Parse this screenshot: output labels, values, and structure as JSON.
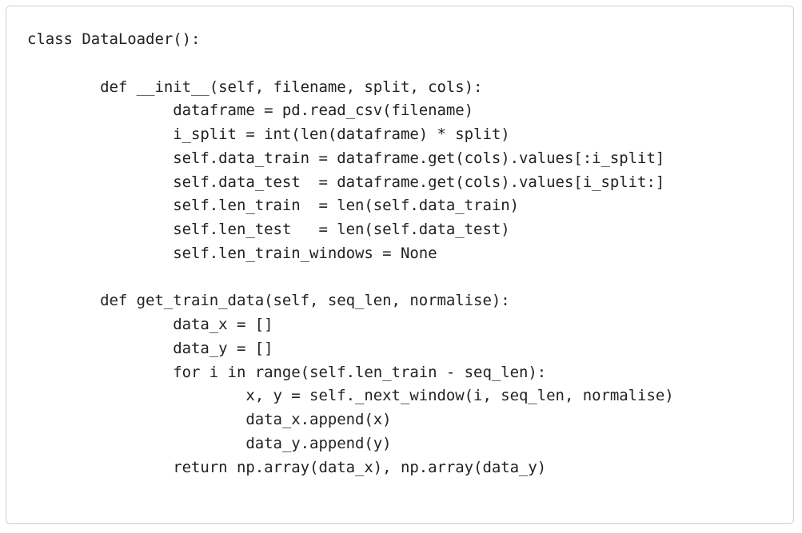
{
  "code": {
    "lines": [
      "class DataLoader():",
      "",
      "        def __init__(self, filename, split, cols):",
      "                dataframe = pd.read_csv(filename)",
      "                i_split = int(len(dataframe) * split)",
      "                self.data_train = dataframe.get(cols).values[:i_split]",
      "                self.data_test  = dataframe.get(cols).values[i_split:]",
      "                self.len_train  = len(self.data_train)",
      "                self.len_test   = len(self.data_test)",
      "                self.len_train_windows = None",
      "",
      "        def get_train_data(self, seq_len, normalise):",
      "                data_x = []",
      "                data_y = []",
      "                for i in range(self.len_train - seq_len):",
      "                        x, y = self._next_window(i, seq_len, normalise)",
      "                        data_x.append(x)",
      "                        data_y.append(y)",
      "                return np.array(data_x), np.array(data_y)"
    ]
  }
}
